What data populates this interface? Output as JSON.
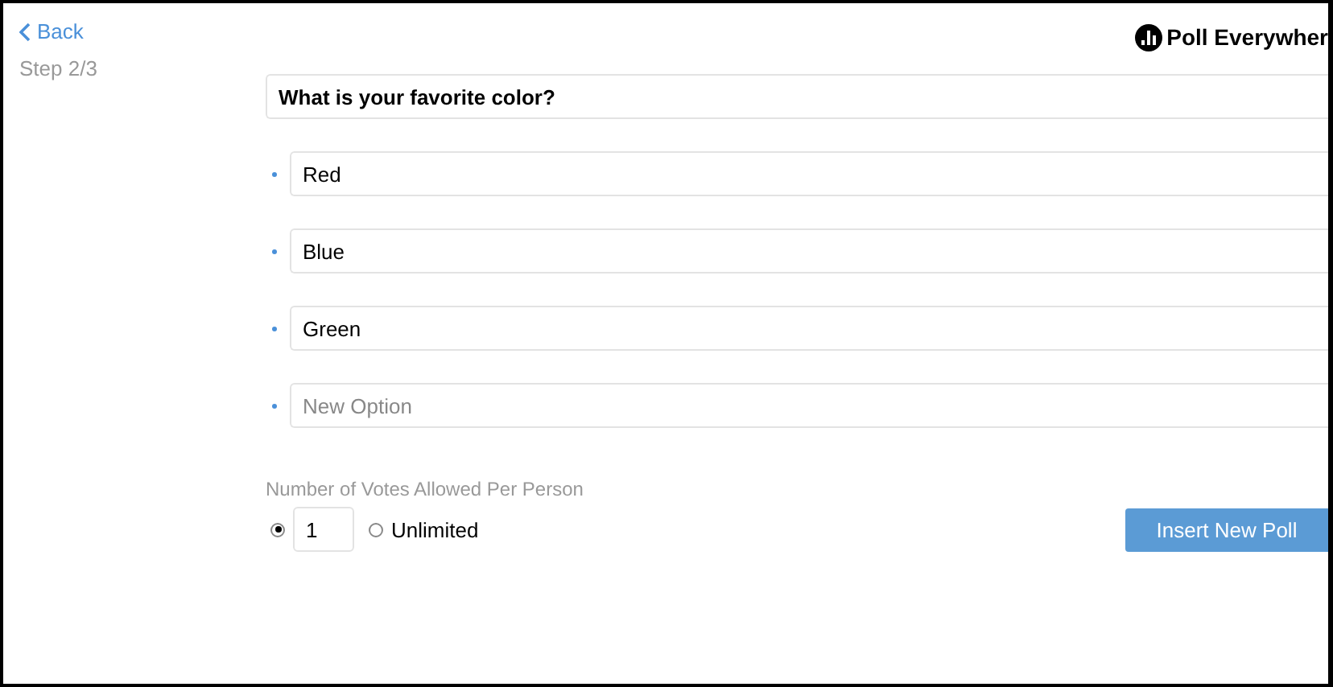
{
  "nav": {
    "back": "Back",
    "step": "Step 2/3"
  },
  "logo": {
    "text": "Poll Everywher"
  },
  "question": {
    "value": "What is your favorite color?"
  },
  "options": [
    {
      "value": "Red"
    },
    {
      "value": "Blue"
    },
    {
      "value": "Green"
    },
    {
      "placeholder": "New Option"
    }
  ],
  "votes": {
    "label": "Number of Votes Allowed Per Person",
    "choices": [
      {
        "kind": "number",
        "value": "1",
        "selected": true
      },
      {
        "kind": "text",
        "label": "Unlimited",
        "selected": false
      }
    ]
  },
  "submit": "Insert New Poll"
}
